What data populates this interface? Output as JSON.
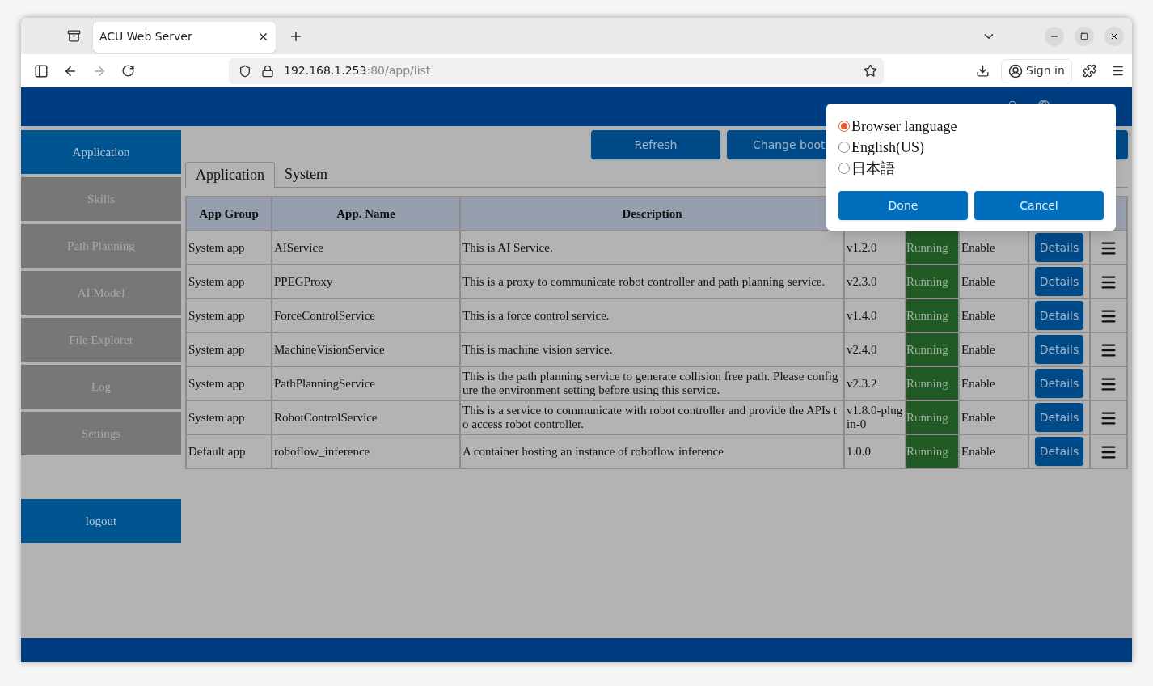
{
  "browser": {
    "tab_title": "ACU Web Server",
    "url_host": "192.168.1.253",
    "url_path": ":80/app/list",
    "sign_in": "Sign in"
  },
  "sidebar": {
    "items": [
      {
        "label": "Application",
        "selected": true
      },
      {
        "label": "Skills",
        "selected": false
      },
      {
        "label": "Path Planning",
        "selected": false
      },
      {
        "label": "AI Model",
        "selected": false
      },
      {
        "label": "File Explorer",
        "selected": false
      },
      {
        "label": "Log",
        "selected": false
      },
      {
        "label": "Settings",
        "selected": false
      }
    ],
    "logout": "logout"
  },
  "toolbar": {
    "buttons": [
      "Refresh",
      "Change boot"
    ]
  },
  "tabs": [
    {
      "label": "Application",
      "selected": true
    },
    {
      "label": "System",
      "selected": false
    }
  ],
  "table": {
    "columns": [
      "App Group",
      "App. Name",
      "Description"
    ],
    "rows": [
      {
        "group": "System app",
        "name": "AIService",
        "description": "This is AI Service.",
        "version": "v1.2.0",
        "status": "Running",
        "mode": "Enable",
        "action": "Details"
      },
      {
        "group": "System app",
        "name": "PPEGProxy",
        "description": "This is a proxy to communicate robot controller and path planning service.",
        "version": "v2.3.0",
        "status": "Running",
        "mode": "Enable",
        "action": "Details"
      },
      {
        "group": "System app",
        "name": "ForceControlService",
        "description": "This is a force control service.",
        "version": "v1.4.0",
        "status": "Running",
        "mode": "Enable",
        "action": "Details"
      },
      {
        "group": "System app",
        "name": "MachineVisionService",
        "description": "This is machine vision service.",
        "version": "v2.4.0",
        "status": "Running",
        "mode": "Enable",
        "action": "Details"
      },
      {
        "group": "System app",
        "name": "PathPlanningService",
        "description": "This is the path planning service to generate collision free path. Please configure the environment setting before using this service.",
        "version": "v2.3.2",
        "status": "Running",
        "mode": "Enable",
        "action": "Details"
      },
      {
        "group": "System app",
        "name": "RobotControlService",
        "description": "This is a service to communicate with robot controller and provide the APIs to access robot controller.",
        "version": "v1.8.0-plugin-0",
        "status": "Running",
        "mode": "Enable",
        "action": "Details"
      },
      {
        "group": "Default app",
        "name": "roboflow_inference",
        "description": "A container hosting an instance of roboflow inference",
        "version": "1.0.0",
        "status": "Running",
        "mode": "Enable",
        "action": "Details"
      }
    ]
  },
  "language_dialog": {
    "options": [
      {
        "label": "Browser language",
        "selected": true
      },
      {
        "label": "English(US)",
        "selected": false
      },
      {
        "label": "日本語",
        "selected": false
      }
    ],
    "buttons": [
      "Done",
      "Cancel"
    ]
  }
}
